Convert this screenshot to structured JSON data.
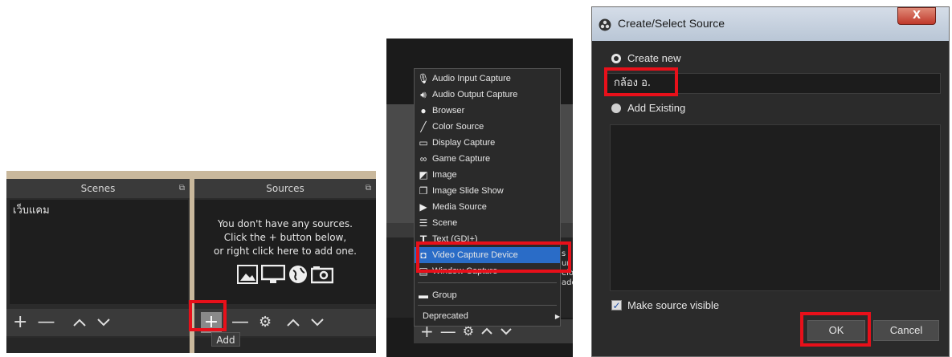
{
  "scenes_panel": {
    "title": "Scenes",
    "items": [
      "เว็บแคม"
    ]
  },
  "sources_panel": {
    "title": "Sources",
    "empty_message": [
      "You don't have any sources.",
      "Click the + button below,",
      "or right click here to add one."
    ]
  },
  "tooltip": {
    "add": "Add"
  },
  "add_menu": {
    "items": [
      {
        "label": "Audio Input Capture",
        "icon": "microphone-icon"
      },
      {
        "label": "Audio Output Capture",
        "icon": "speaker-icon"
      },
      {
        "label": "Browser",
        "icon": "globe-icon"
      },
      {
        "label": "Color Source",
        "icon": "brush-icon"
      },
      {
        "label": "Display Capture",
        "icon": "monitor-icon"
      },
      {
        "label": "Game Capture",
        "icon": "gamepad-icon"
      },
      {
        "label": "Image",
        "icon": "image-icon"
      },
      {
        "label": "Image Slide Show",
        "icon": "slideshow-icon"
      },
      {
        "label": "Media Source",
        "icon": "play-icon"
      },
      {
        "label": "Scene",
        "icon": "list-icon"
      },
      {
        "label": "Text (GDI+)",
        "icon": "text-icon"
      },
      {
        "label": "Video Capture Device",
        "icon": "camera-icon",
        "selected": true
      },
      {
        "label": "Window Capture",
        "icon": "window-icon"
      },
      {
        "label": "Group",
        "icon": "folder-icon"
      },
      {
        "label": "Deprecated",
        "icon": "",
        "submenu": true
      }
    ],
    "bg_fragments": [
      "s",
      "ur",
      "elo",
      "add"
    ]
  },
  "dialog": {
    "title": "Create/Select Source",
    "create_new_label": "Create new",
    "name_value": "กล้อง อ.",
    "add_existing_label": "Add Existing",
    "make_visible_label": "Make source visible",
    "ok_label": "OK",
    "cancel_label": "Cancel",
    "close_glyph": "X"
  },
  "colors": {
    "highlight_red": "#e8101a",
    "menu_selected": "#2a6cc7",
    "obs_dark": "#2b2b2b"
  }
}
